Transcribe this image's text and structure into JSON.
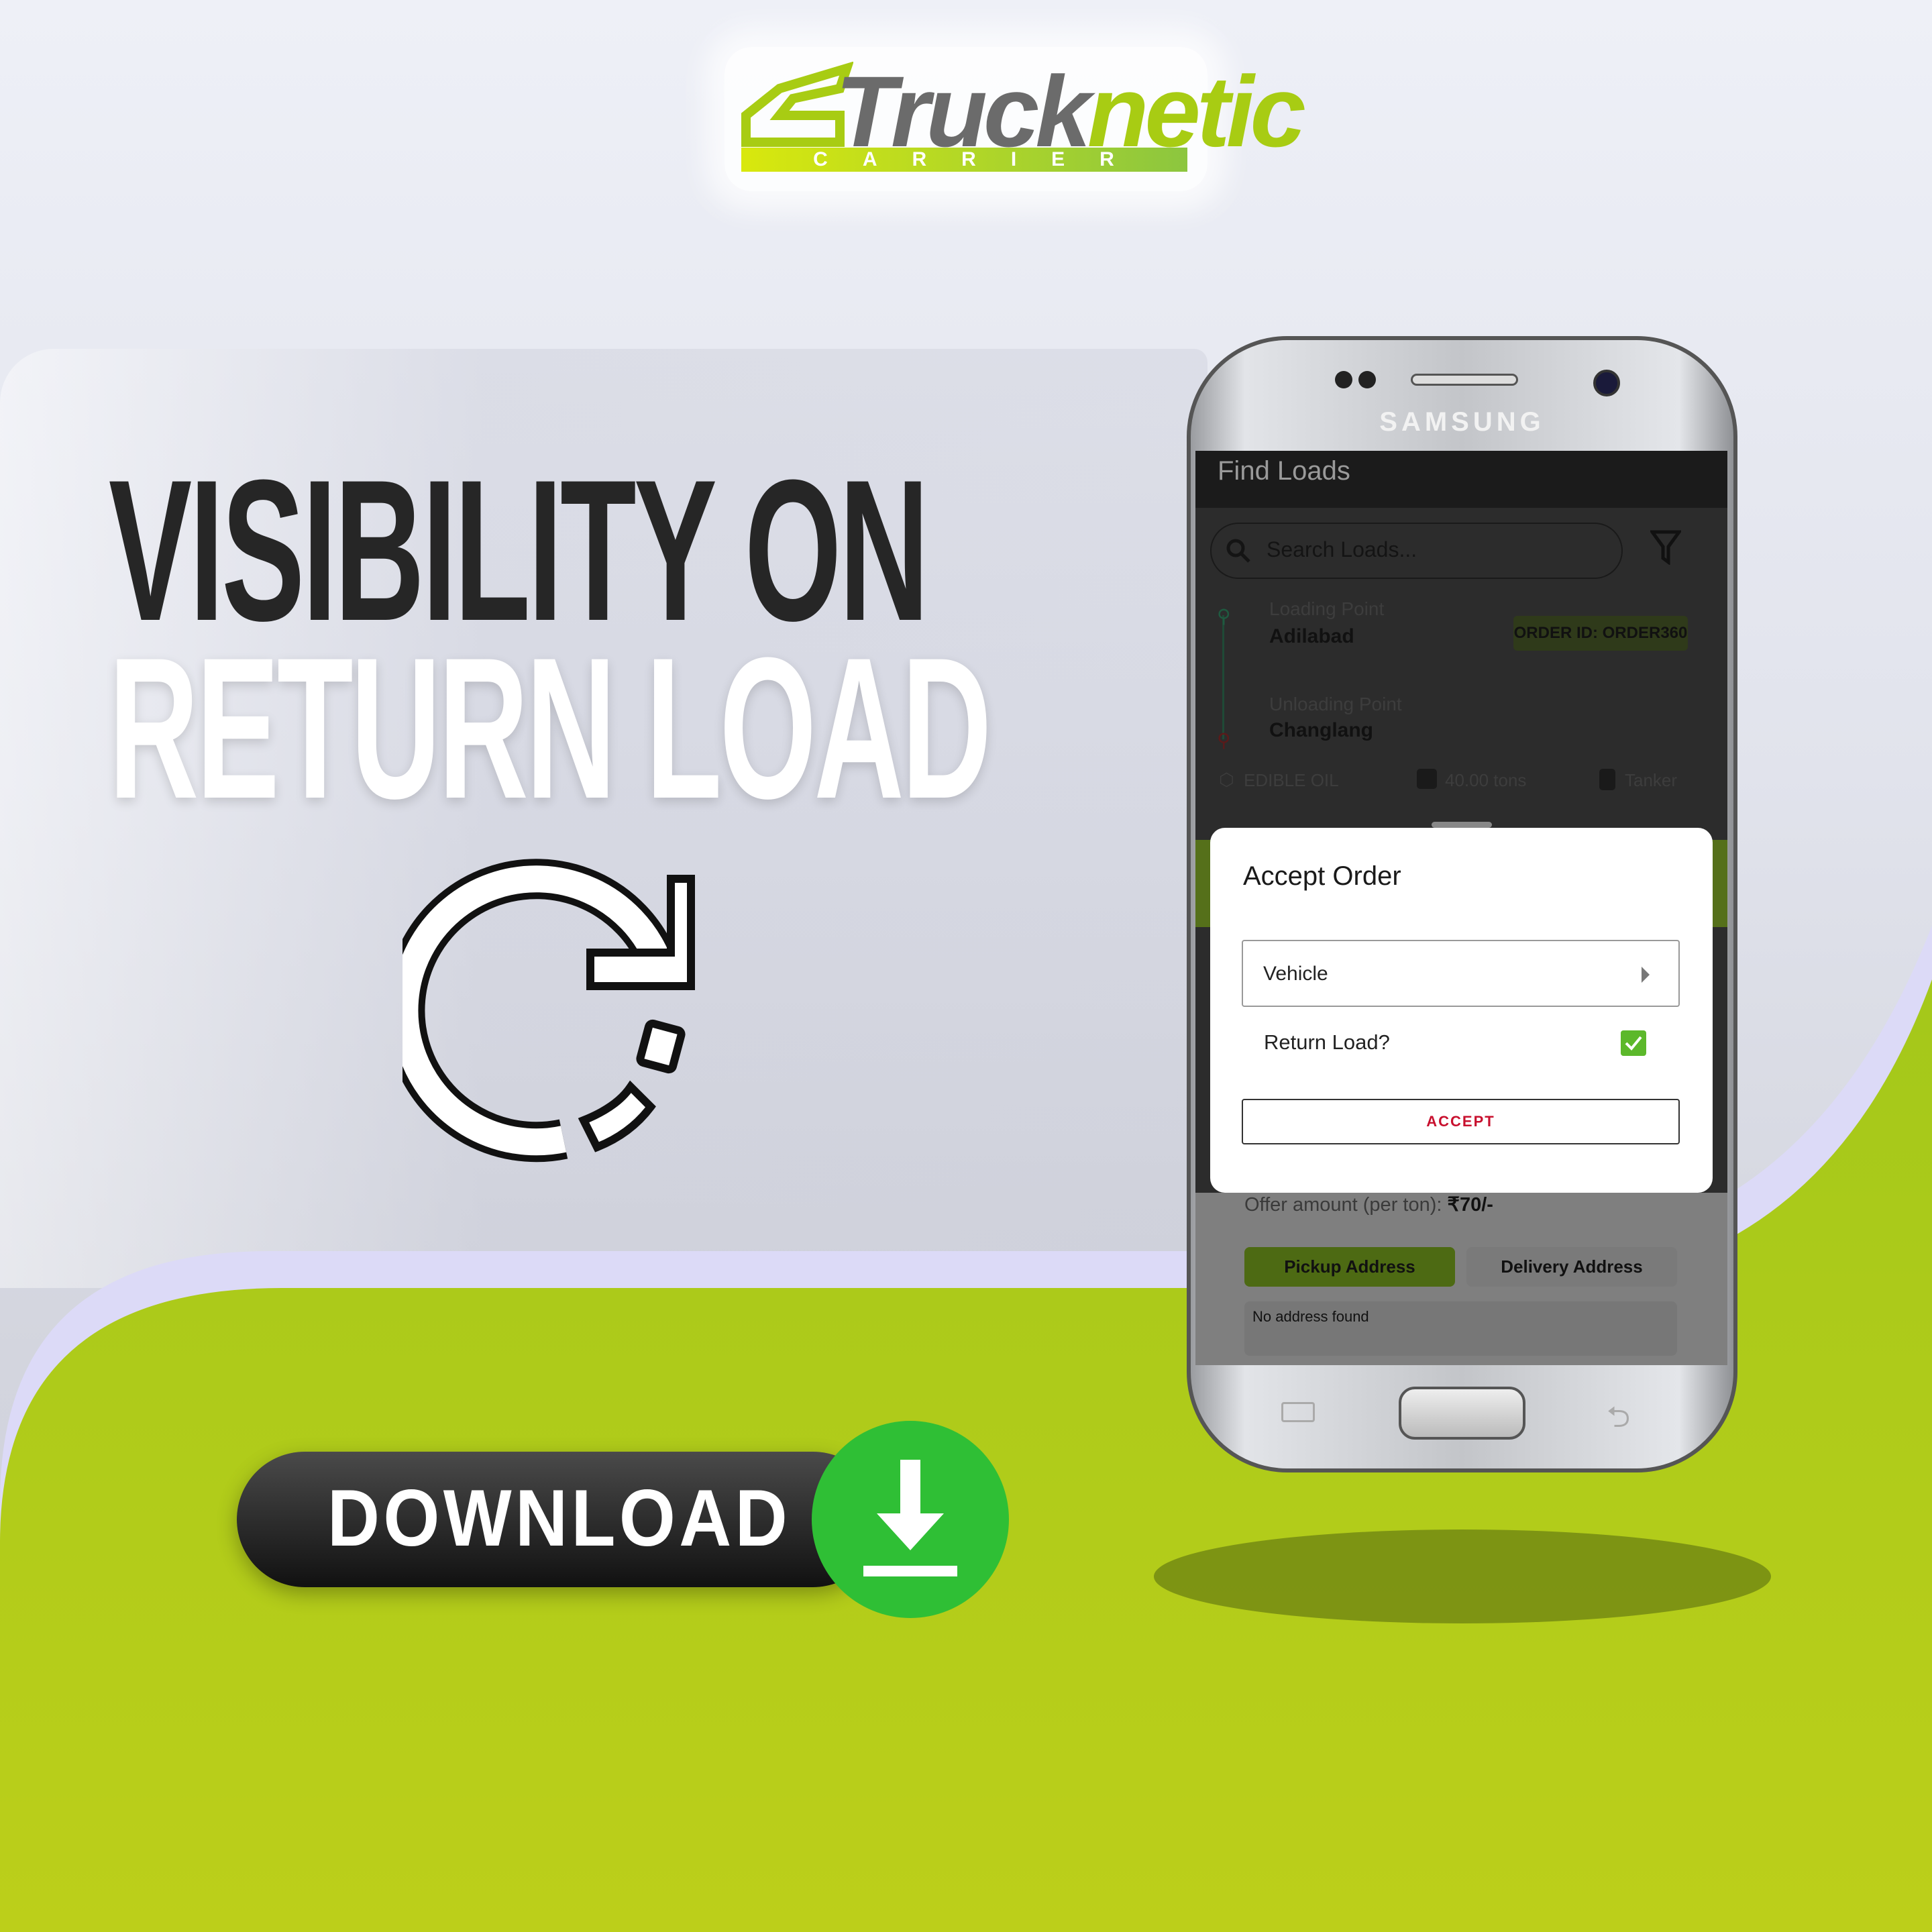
{
  "brand": {
    "name_part1": "Truck",
    "name_part2": "netic",
    "subtitle": "CARRIER",
    "accent": "#a8cc13"
  },
  "headline": {
    "line1": "VISIBILITY ON",
    "line2": "RETURN LOAD"
  },
  "icons": {
    "refresh": "refresh-arrow-icon",
    "download": "download-arrow-icon"
  },
  "download": {
    "label": "DOWNLOAD",
    "color": "#2fbf35"
  },
  "phone": {
    "brand": "SAMSUNG",
    "app_title": "Find Loads",
    "search": {
      "placeholder": "Search Loads..."
    },
    "load": {
      "loading_label": "Loading Point",
      "loading_value": "Adilabad",
      "unloading_label": "Unloading Point",
      "unloading_value": "Changlang",
      "order_id": "ORDER ID: ORDER360",
      "material": "EDIBLE OIL",
      "weight": "40.00 tons",
      "vehicle_type": "Tanker"
    },
    "dialog": {
      "title": "Accept Order",
      "vehicle_label": "Vehicle",
      "return_load_label": "Return Load?",
      "return_load_checked": true,
      "accept_label": "ACCEPT"
    },
    "offer": {
      "label": "Offer amount (per ton): ",
      "value": "₹70/-"
    },
    "tabs": [
      {
        "label": "Pickup Address",
        "active": true
      },
      {
        "label": "Delivery Address",
        "active": false
      }
    ],
    "address_empty": "No address found"
  }
}
